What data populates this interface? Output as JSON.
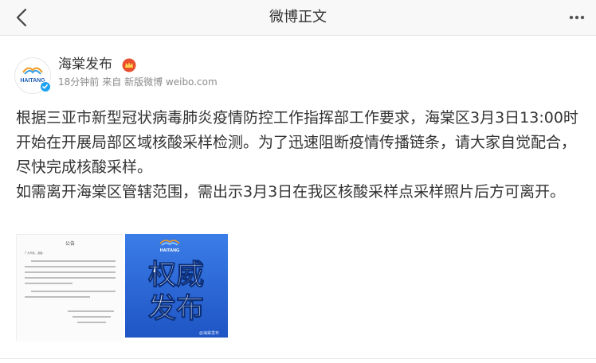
{
  "header": {
    "title": "微博正文",
    "back_icon": "chevron-left-icon",
    "more_icon": "more-dots-icon"
  },
  "author": {
    "name": "海棠发布",
    "time": "18分钟前",
    "source": "来自 新版微博 weibo.com",
    "avatar_logo_text": "HAITANG",
    "verified_color": "#1da1f2",
    "badge_color": "#e94f2e"
  },
  "post": {
    "paragraph1": "根据三亚市新型冠状病毒肺炎疫情防控工作指挥部工作要求，海棠区3月3日13:00时开始在开展局部区域核酸采样检测。为了迅速阻断疫情传播链条，请大家自觉配合，尽快完成核酸采样。",
    "paragraph2": "如需离开海棠区管辖范围，需出示3月3日在我区核酸采样点采样照片后方可离开。"
  },
  "images": {
    "notice": {
      "heading": "公告",
      "salutation": "广大市民、游客：",
      "body1": "根据三亚市新型冠状病毒肺炎疫情防控工作指挥部工作要求，海棠区3月3日13:00时开始在开展局部区域核酸采样检测，为了迅速阻断疫情传播链条，请大家自觉配合，尽快完成核酸采样。",
      "body2": "如需离开海棠区管辖范围，需出示3月3日在我区核酸采样点采样照片后方可离开。",
      "sign1": "三亚市海棠区新冠肺炎疫情",
      "sign2": "防控工作指挥部",
      "date": "2022年3月3日"
    },
    "authority": {
      "logo_text": "HAITANG",
      "line1": "权威",
      "line2": "发布",
      "watermark": "@海棠发布",
      "bg_color": "#2d6bd8"
    }
  }
}
